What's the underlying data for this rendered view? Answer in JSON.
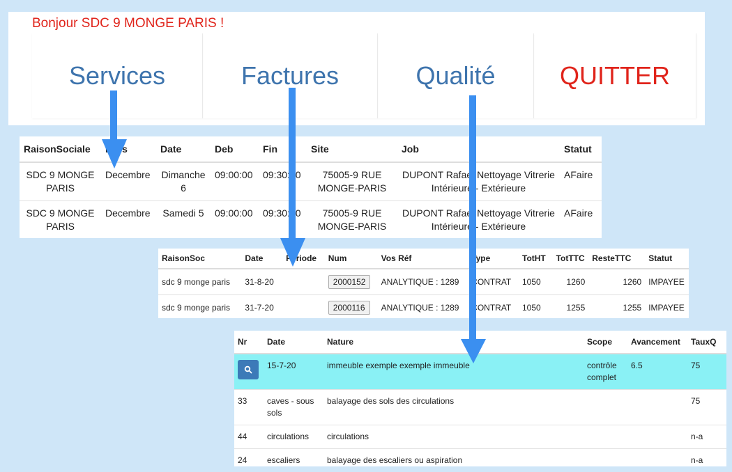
{
  "header": {
    "greeting": "Bonjour SDC 9 MONGE PARIS !",
    "nav": [
      "Services",
      "Factures",
      "Qualité",
      "QUITTER"
    ]
  },
  "services": {
    "columns": [
      "RaisonSociale",
      "Mois",
      "Date",
      "Deb",
      "Fin",
      "Site",
      "Job",
      "Statut"
    ],
    "rows": [
      [
        "SDC 9 MONGE PARIS",
        "Decembre",
        "Dimanche 6",
        "09:00:00",
        "09:30:00",
        "75005-9 RUE MONGE-PARIS",
        "DUPONT Rafael Nettoyage Vitrerie Intérieure - Extérieure",
        "AFaire"
      ],
      [
        "SDC 9 MONGE PARIS",
        "Decembre",
        "Samedi 5",
        "09:00:00",
        "09:30:00",
        "75005-9 RUE MONGE-PARIS",
        "DUPONT Rafael Nettoyage Vitrerie Intérieure - Extérieure",
        "AFaire"
      ]
    ]
  },
  "factures": {
    "columns": [
      "RaisonSoc",
      "Date",
      "Période",
      "Num",
      "Vos Réf",
      "Type",
      "TotHT",
      "TotTTC",
      "ResteTTC",
      "Statut"
    ],
    "rows": [
      [
        "sdc 9 monge paris",
        "31-8-20",
        "",
        "2000152",
        "ANALYTIQUE : 1289",
        "CONTRAT",
        "1050",
        "1260",
        "1260",
        "IMPAYEE"
      ],
      [
        "sdc 9 monge paris",
        "31-7-20",
        "",
        "2000116",
        "ANALYTIQUE : 1289",
        "CONTRAT",
        "1050",
        "1255",
        "1255",
        "IMPAYEE"
      ]
    ]
  },
  "qualite": {
    "columns": [
      "Nr",
      "Date",
      "Nature",
      "Scope",
      "Avancement",
      "TauxQ"
    ],
    "rows": [
      [
        "",
        "15-7-20",
        "immeuble exemple exemple immeuble",
        "contrôle complet",
        "6.5",
        "75"
      ],
      [
        "33",
        "caves - sous sols",
        "balayage des sols des circulations",
        "",
        "",
        "75"
      ],
      [
        "44",
        "circulations",
        "circulations",
        "",
        "",
        "n-a"
      ],
      [
        "24",
        "escaliers",
        "balayage des escaliers ou aspiration",
        "",
        "",
        "n-a"
      ]
    ]
  },
  "icons": {
    "search": "search-icon"
  },
  "colors": {
    "accent_blue": "#3e74ad",
    "quit_red": "#e0241b",
    "highlight": "#8af1f5",
    "arrow": "#3b8ff0"
  }
}
